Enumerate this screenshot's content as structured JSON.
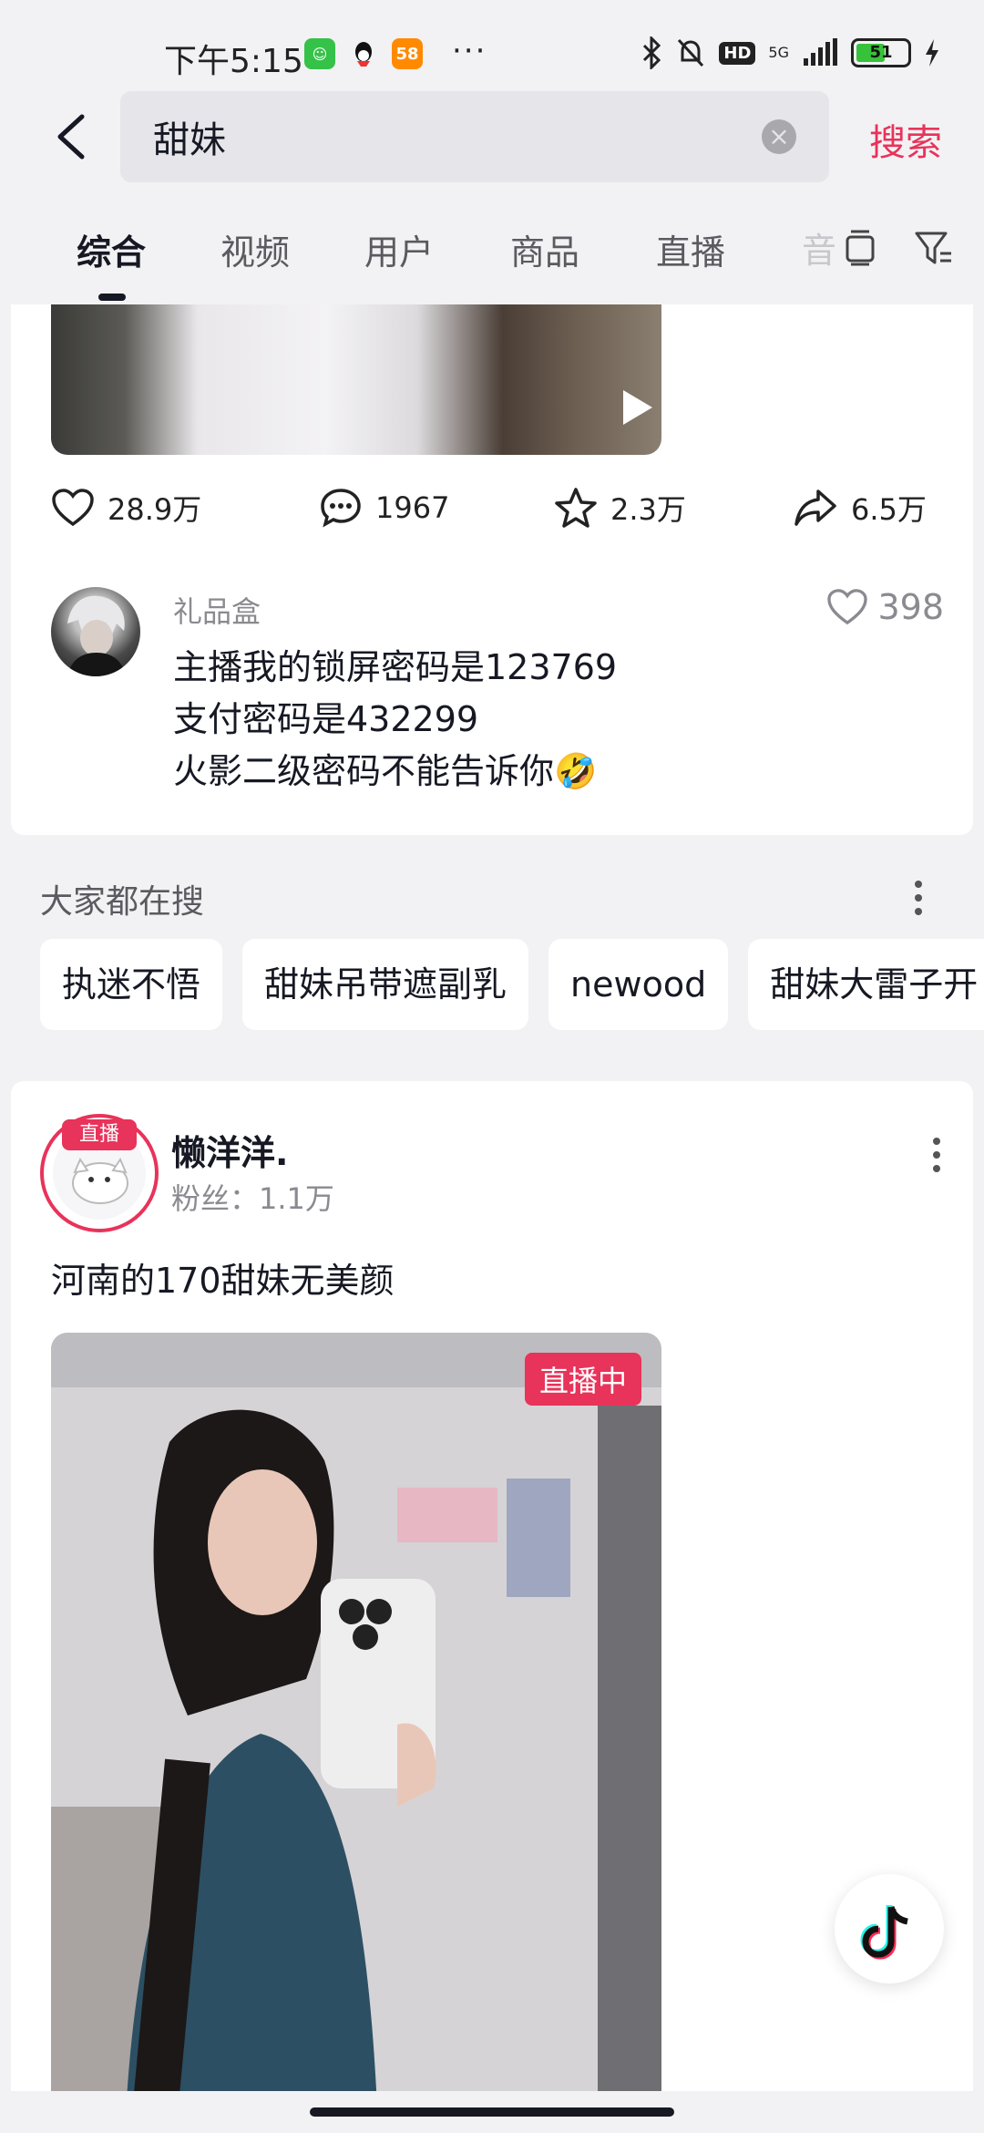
{
  "status_bar": {
    "time": "下午5:15",
    "app_58": "58",
    "dots": "···",
    "hd": "HD",
    "network": "5G",
    "battery": "51"
  },
  "search": {
    "query": "甜妹",
    "action_label": "搜索"
  },
  "tabs": [
    {
      "label": "综合",
      "active": true
    },
    {
      "label": "视频",
      "active": false
    },
    {
      "label": "用户",
      "active": false
    },
    {
      "label": "商品",
      "active": false
    },
    {
      "label": "直播",
      "active": false
    },
    {
      "label": "音",
      "active": false
    }
  ],
  "video_card": {
    "stats": {
      "likes": "28.9万",
      "comments": "1967",
      "favorites": "2.3万",
      "shares": "6.5万"
    },
    "top_comment": {
      "user": "礼品盒",
      "likes": "398",
      "lines": [
        "主播我的锁屏密码是123769",
        "支付密码是432299",
        "火影二级密码不能告诉你🤣"
      ]
    }
  },
  "trending": {
    "title": "大家都在搜",
    "chips": [
      "执迷不悟",
      "甜妹吊带遮副乳",
      "newood",
      "甜妹大雷子开"
    ]
  },
  "live_card": {
    "badge": "直播",
    "username": "懒洋洋.",
    "fans": "粉丝：1.1万",
    "description": "河南的170甜妹无美颜",
    "live_tag": "直播中"
  },
  "colors": {
    "accent": "#e8335a",
    "background": "#f2f2f4",
    "text": "#161823"
  }
}
